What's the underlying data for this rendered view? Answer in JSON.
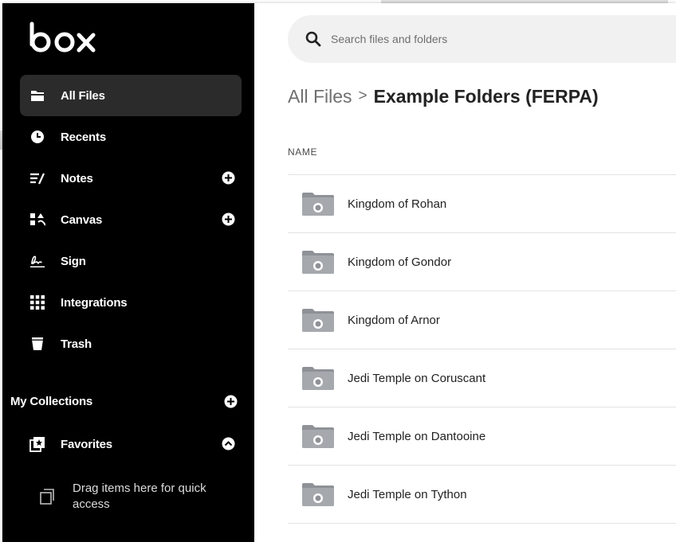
{
  "brand": {
    "logo_text": "box",
    "sidebar_bg": "#000000",
    "accent": "#ffffff"
  },
  "sidebar": {
    "items": [
      {
        "label": "All Files",
        "icon": "folder-icon",
        "active": true
      },
      {
        "label": "Recents",
        "icon": "clock-icon"
      },
      {
        "label": "Notes",
        "icon": "notes-icon",
        "has_add": true
      },
      {
        "label": "Canvas",
        "icon": "canvas-icon",
        "has_add": true
      },
      {
        "label": "Sign",
        "icon": "signature-icon"
      },
      {
        "label": "Integrations",
        "icon": "grid-icon"
      },
      {
        "label": "Trash",
        "icon": "trash-icon"
      }
    ],
    "collections_label": "My Collections",
    "favorites_label": "Favorites",
    "drag_hint": "Drag items here for quick access"
  },
  "search": {
    "placeholder": "Search files and folders"
  },
  "breadcrumb": {
    "root": "All Files",
    "separator": ">",
    "current": "Example Folders (FERPA)"
  },
  "table": {
    "column_name": "NAME",
    "rows": [
      {
        "name": "Kingdom of Rohan"
      },
      {
        "name": "Kingdom of Gondor"
      },
      {
        "name": "Kingdom of Arnor"
      },
      {
        "name": "Jedi Temple on Coruscant"
      },
      {
        "name": "Jedi Temple on Dantooine"
      },
      {
        "name": "Jedi Temple on Tython"
      }
    ]
  }
}
